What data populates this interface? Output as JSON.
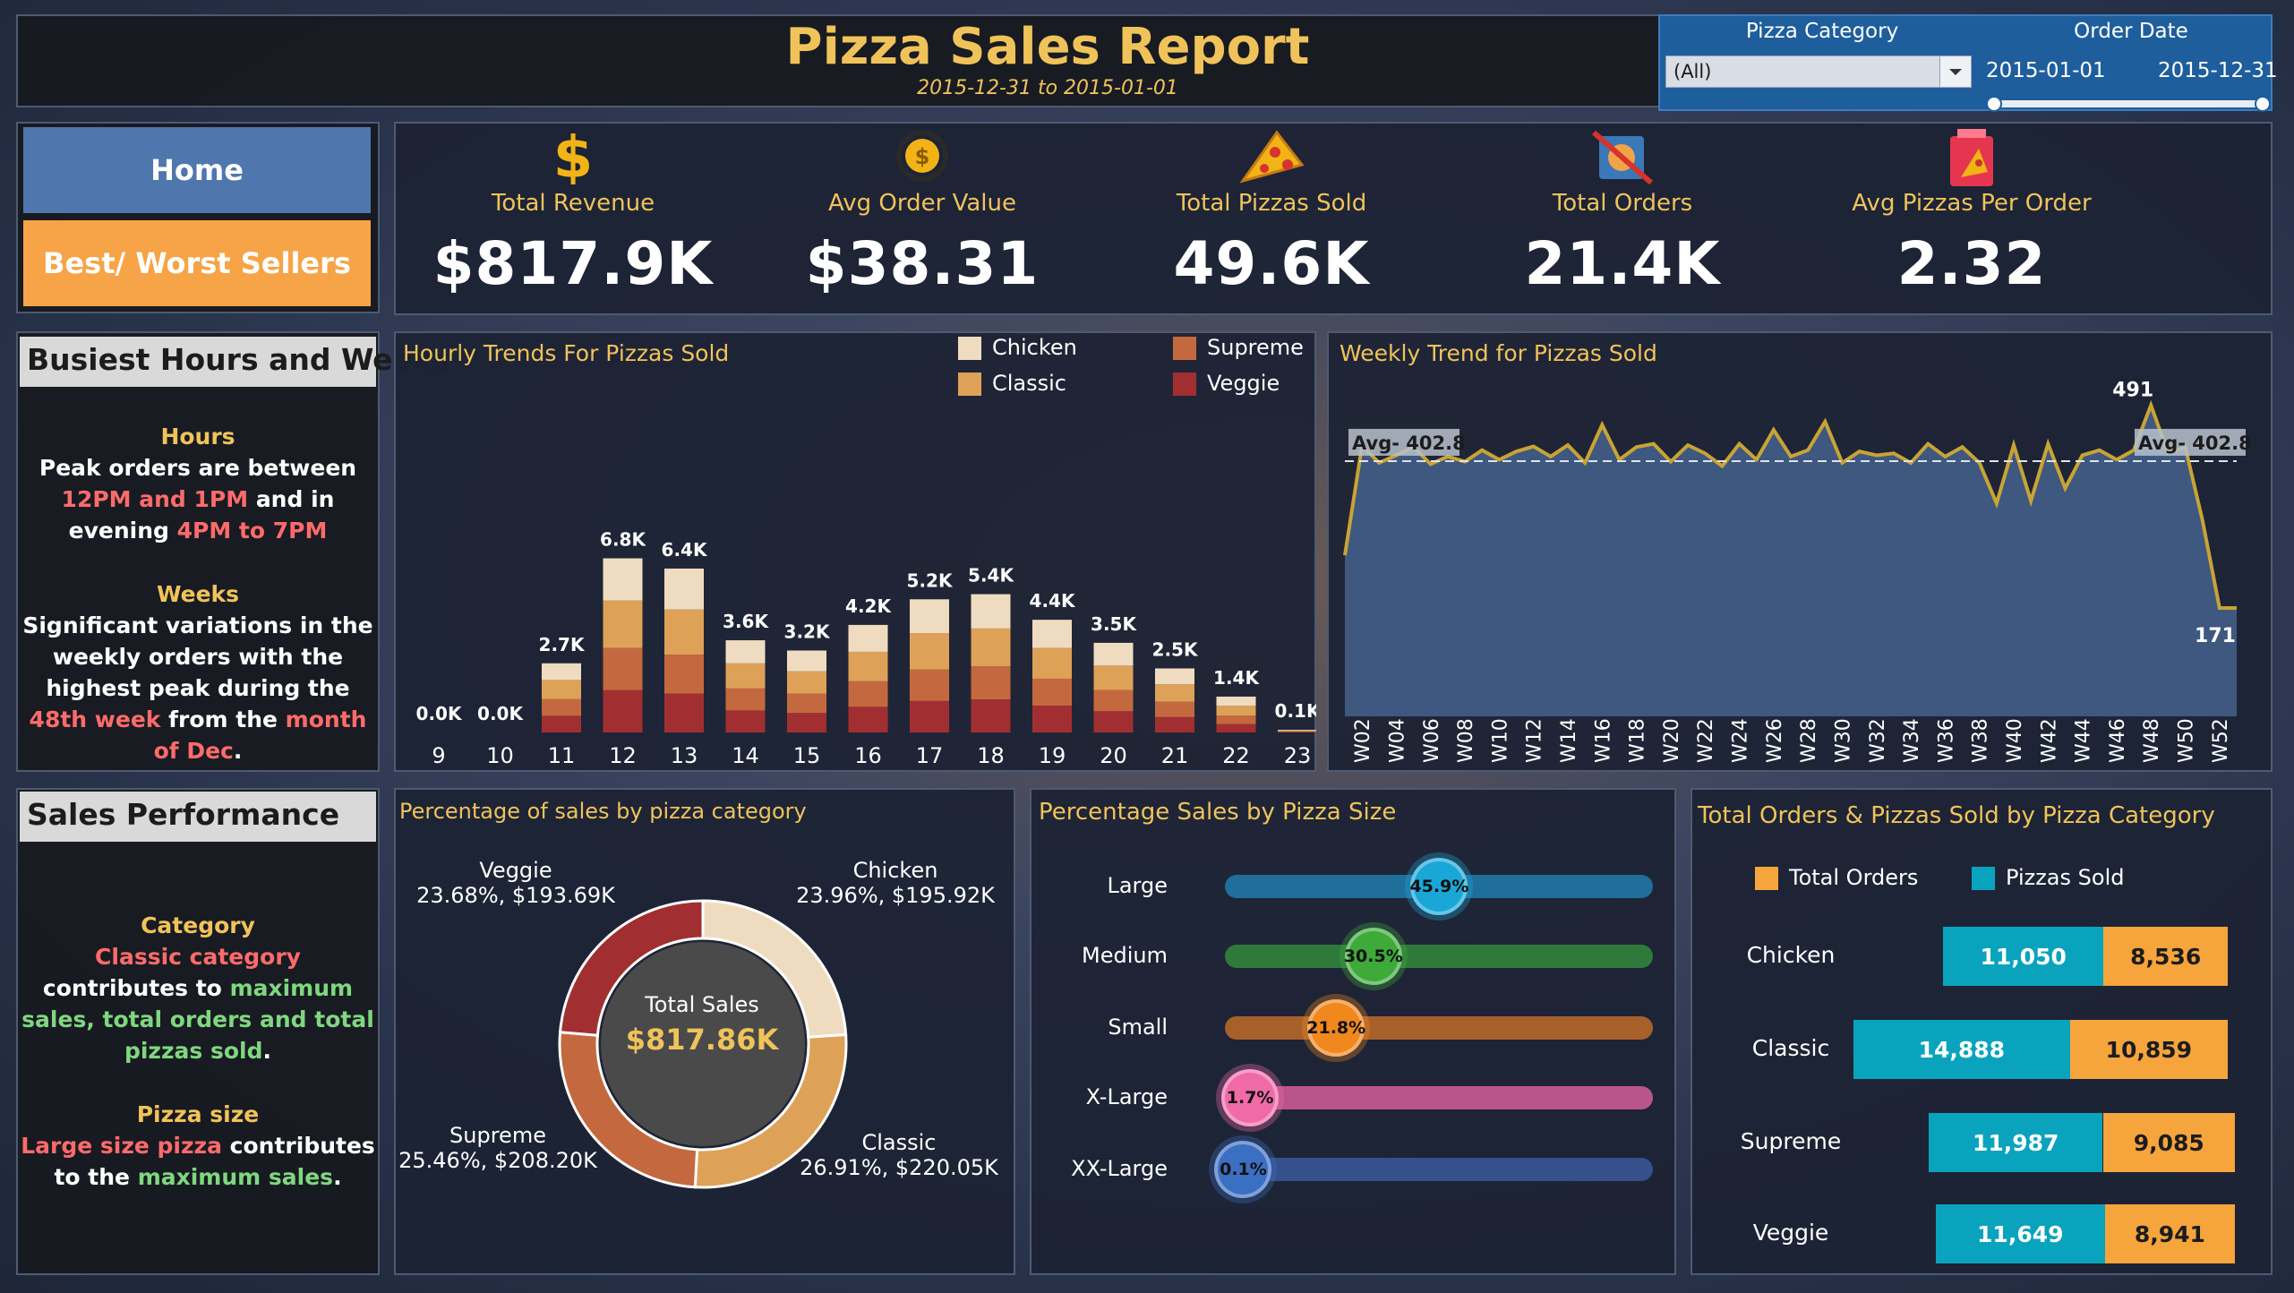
{
  "header": {
    "title": "Pizza Sales Report",
    "subtitle": "2015-12-31 to 2015-01-01"
  },
  "filters": {
    "category_label": "Pizza Category",
    "category_value": "(All)",
    "date_label": "Order Date",
    "date_start": "2015-01-01",
    "date_end": "2015-12-31"
  },
  "nav": {
    "home": "Home",
    "best_worst": "Best/ Worst Sellers"
  },
  "kpis": [
    {
      "label": "Total Revenue",
      "value": "$817.9K",
      "icon": "dollar-icon"
    },
    {
      "label": "Avg Order Value",
      "value": "$38.31",
      "icon": "coin-icon"
    },
    {
      "label": "Total Pizzas Sold",
      "value": "49.6K",
      "icon": "pizza-slice-icon"
    },
    {
      "label": "Total Orders",
      "value": "21.4K",
      "icon": "pizza-box-icon"
    },
    {
      "label": "Avg Pizzas Per Order",
      "value": "2.32",
      "icon": "pizza-bag-icon"
    }
  ],
  "busiest": {
    "title": "Busiest Hours and Weeks",
    "hours_heading": "Hours",
    "hours_p1": "Peak orders are between ",
    "hours_h1": "12PM and 1PM",
    "hours_p2": "  and in evening ",
    "hours_h2": "4PM to 7PM",
    "weeks_heading": "Weeks",
    "weeks_p1": "Significant variations in the weekly orders with the highest peak during the ",
    "weeks_h1": "48th week",
    "weeks_p2": " from the ",
    "weeks_h2": "month of Dec",
    "weeks_p3": "."
  },
  "sales_perf": {
    "title": "Sales Performance",
    "cat_heading": "Category",
    "cat_h1": "Classic category",
    "cat_p1": " contributes to ",
    "cat_h2": "maximum sales, total orders and total pizzas sold",
    "cat_p2": ".",
    "size_heading": "Pizza size",
    "size_h1": "Large size pizza",
    "size_p1": " contributes to the ",
    "size_h2": "maximum sales",
    "size_p2": "."
  },
  "hourly": {
    "title": "Hourly Trends For Pizzas Sold",
    "legend": [
      {
        "name": "Chicken",
        "color": "#efdcc0"
      },
      {
        "name": "Supreme",
        "color": "#c4693f"
      },
      {
        "name": "Classic",
        "color": "#dea158"
      },
      {
        "name": "Veggie",
        "color": "#a12f31"
      }
    ]
  },
  "weekly": {
    "title": "Weekly Trend for Pizzas Sold",
    "avg_label_left": "Avg- 402.8",
    "avg_label_right": "Avg- 402.8",
    "max_label": "491",
    "min_label": "171"
  },
  "category_pct": {
    "title": "Percentage of sales by pizza category",
    "center_label": "Total Sales",
    "center_value": "$817.86K",
    "labels": [
      {
        "name": "Veggie",
        "detail": "23.68%, $193.69K"
      },
      {
        "name": "Chicken",
        "detail": "23.96%, $195.92K"
      },
      {
        "name": "Supreme",
        "detail": "25.46%, $208.20K"
      },
      {
        "name": "Classic",
        "detail": "26.91%, $220.05K"
      }
    ]
  },
  "size_pct": {
    "title": "Percentage Sales by Pizza Size",
    "rows": [
      {
        "label": "Large",
        "pct": "45.9%",
        "value": 45.9,
        "color": "#1aa7d8",
        "track": "#1f6f9a"
      },
      {
        "label": "Medium",
        "pct": "30.5%",
        "value": 30.5,
        "color": "#3eaa3a",
        "track": "#2f7a3a"
      },
      {
        "label": "Small",
        "pct": "21.8%",
        "value": 21.8,
        "color": "#f0881e",
        "track": "#a8602a"
      },
      {
        "label": "X-Large",
        "pct": "1.7%",
        "value": 1.7,
        "color": "#f06aa8",
        "track": "#b9558a"
      },
      {
        "label": "XX-Large",
        "pct": "0.1%",
        "value": 0.1,
        "color": "#3b6fc2",
        "track": "#35508a"
      }
    ]
  },
  "orders_by_cat": {
    "title": "Total Orders & Pizzas Sold by Pizza Category",
    "legend_orders": "Total Orders",
    "legend_sold": "Pizzas Sold",
    "orders_color": "#f6a43c",
    "sold_color": "#0aa3bd",
    "rows": [
      {
        "label": "Chicken",
        "sold": "11,050",
        "orders": "8,536",
        "sold_n": 11050,
        "orders_n": 8536
      },
      {
        "label": "Classic",
        "sold": "14,888",
        "orders": "10,859",
        "sold_n": 14888,
        "orders_n": 10859
      },
      {
        "label": "Supreme",
        "sold": "11,987",
        "orders": "9,085",
        "sold_n": 11987,
        "orders_n": 9085
      },
      {
        "label": "Veggie",
        "sold": "11,649",
        "orders": "8,941",
        "sold_n": 11649,
        "orders_n": 8941
      }
    ]
  },
  "chart_data": [
    {
      "type": "bar",
      "title": "Hourly Trends For Pizzas Sold",
      "stacked": true,
      "categories": [
        "9",
        "10",
        "11",
        "12",
        "13",
        "14",
        "15",
        "16",
        "17",
        "18",
        "19",
        "20",
        "21",
        "22",
        "23"
      ],
      "totals_labels": [
        "0.0K",
        "0.0K",
        "2.7K",
        "6.8K",
        "6.4K",
        "3.6K",
        "3.2K",
        "4.2K",
        "5.2K",
        "5.4K",
        "4.4K",
        "3.5K",
        "2.5K",
        "1.4K",
        "0.1K"
      ],
      "series": [
        {
          "name": "Veggie",
          "values": [
            0,
            0,
            650,
            1650,
            1520,
            860,
            760,
            1000,
            1230,
            1290,
            1050,
            830,
            600,
            330,
            20
          ]
        },
        {
          "name": "Supreme",
          "values": [
            0,
            0,
            650,
            1650,
            1520,
            860,
            760,
            1000,
            1230,
            1290,
            1050,
            830,
            600,
            330,
            20
          ]
        },
        {
          "name": "Classic",
          "values": [
            0,
            0,
            750,
            1850,
            1760,
            980,
            870,
            1150,
            1420,
            1480,
            1200,
            950,
            680,
            380,
            30
          ]
        },
        {
          "name": "Chicken",
          "values": [
            0,
            0,
            650,
            1650,
            1600,
            900,
            810,
            1050,
            1320,
            1340,
            1100,
            890,
            620,
            360,
            30
          ]
        }
      ],
      "legend": "top-right"
    },
    {
      "type": "area",
      "title": "Weekly Trend for Pizzas Sold",
      "x": [
        "W01",
        "W02",
        "W03",
        "W04",
        "W05",
        "W06",
        "W07",
        "W08",
        "W09",
        "W10",
        "W11",
        "W12",
        "W13",
        "W14",
        "W15",
        "W16",
        "W17",
        "W18",
        "W19",
        "W20",
        "W21",
        "W22",
        "W23",
        "W24",
        "W25",
        "W26",
        "W27",
        "W28",
        "W29",
        "W30",
        "W31",
        "W32",
        "W33",
        "W34",
        "W35",
        "W36",
        "W37",
        "W38",
        "W39",
        "W40",
        "W41",
        "W42",
        "W43",
        "W44",
        "W45",
        "W46",
        "W47",
        "W48",
        "W49",
        "W50",
        "W51",
        "W52",
        "W53"
      ],
      "x_tick_labels": [
        "W02",
        "W04",
        "W06",
        "W08",
        "W10",
        "W12",
        "W14",
        "W16",
        "W18",
        "W20",
        "W22",
        "W24",
        "W26",
        "W28",
        "W30",
        "W32",
        "W34",
        "W36",
        "W38",
        "W40",
        "W42",
        "W44",
        "W46",
        "W48",
        "W50",
        "W52"
      ],
      "values": [
        254,
        427,
        400,
        412,
        425,
        398,
        410,
        402,
        420,
        405,
        418,
        426,
        410,
        428,
        400,
        460,
        405,
        425,
        430,
        402,
        428,
        415,
        395,
        430,
        405,
        452,
        410,
        420,
        465,
        400,
        418,
        412,
        415,
        400,
        430,
        410,
        425,
        400,
        336,
        428,
        340,
        430,
        360,
        412,
        420,
        405,
        420,
        491,
        415,
        425,
        310,
        171,
        171
      ],
      "average": 402.8,
      "ylim": [
        0,
        520
      ],
      "grid": false
    },
    {
      "type": "pie",
      "title": "Percentage of sales by pizza category",
      "categories": [
        "Chicken",
        "Classic",
        "Supreme",
        "Veggie"
      ],
      "values": [
        23.96,
        26.91,
        25.46,
        23.68
      ],
      "amounts": [
        "$195.92K",
        "$220.05K",
        "$208.20K",
        "$193.69K"
      ],
      "colors": [
        "#efdcc0",
        "#dea158",
        "#c4693f",
        "#a12f31"
      ]
    },
    {
      "type": "bar",
      "title": "Percentage Sales by Pizza Size",
      "categories": [
        "Large",
        "Medium",
        "Small",
        "X-Large",
        "XX-Large"
      ],
      "values": [
        45.9,
        30.5,
        21.8,
        1.7,
        0.1
      ]
    },
    {
      "type": "bar",
      "title": "Total Orders & Pizzas Sold by Pizza Category",
      "categories": [
        "Chicken",
        "Classic",
        "Supreme",
        "Veggie"
      ],
      "series": [
        {
          "name": "Pizzas Sold",
          "values": [
            11050,
            14888,
            11987,
            11649
          ]
        },
        {
          "name": "Total Orders",
          "values": [
            8536,
            10859,
            9085,
            8941
          ]
        }
      ]
    }
  ]
}
